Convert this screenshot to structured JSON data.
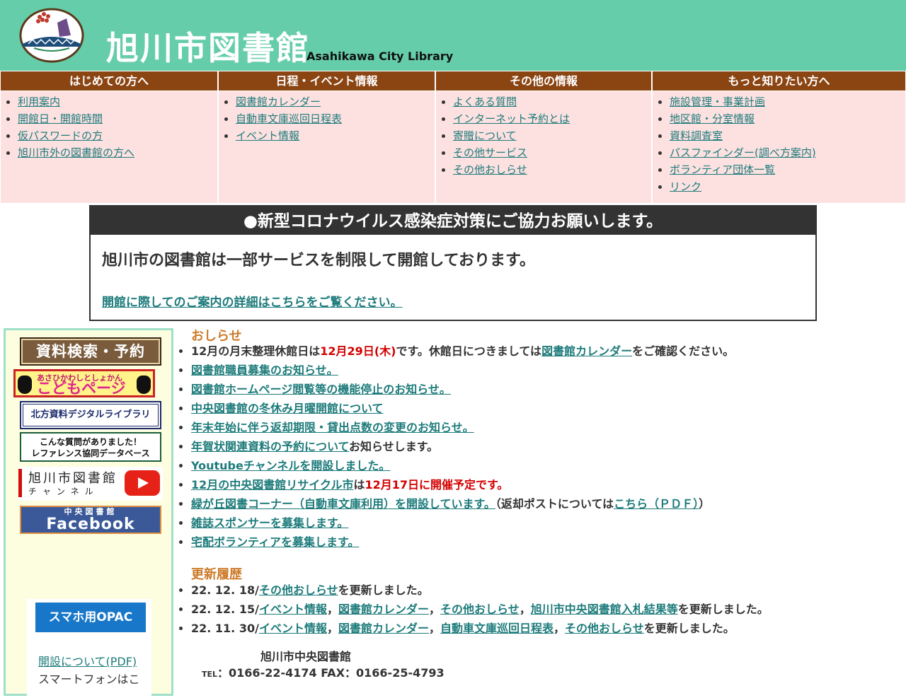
{
  "header": {
    "title": "旭川市図書館",
    "subtitle": "Asahikawa City Library",
    "logo_text": "あさひかわしとしょかん"
  },
  "nav": [
    {
      "heading": "はじめての方へ",
      "items": [
        "利用案内",
        "開館日・開館時間",
        "仮パスワードの方",
        "旭川市外の図書館の方へ"
      ]
    },
    {
      "heading": "日程・イベント情報",
      "items": [
        "図書館カレンダー",
        "自動車文庫巡回日程表",
        "イベント情報"
      ]
    },
    {
      "heading": "その他の情報",
      "items": [
        "よくある質問",
        "インターネット予約とは",
        "寄贈について",
        "その他サービス",
        "その他おしらせ"
      ]
    },
    {
      "heading": "もっと知りたい方へ",
      "items": [
        "施設管理・事業計画",
        "地区館・分室情報",
        "資料調査室",
        "パスファインダー(調べ方案内)",
        "ボランティア団体一覧",
        "リンク"
      ]
    }
  ],
  "notice": {
    "title": "●新型コロナウイルス感染症対策にご協力お願いします。",
    "body": "旭川市の図書館は一部サービスを制限して開館しております。",
    "link": "開館に際してのご案内の詳細はこちらをご覧ください。"
  },
  "sidebar": {
    "search_banner": "資料検索・予約",
    "kids_small": "あさひかわしとしょかん",
    "kids_big": "こどもページ",
    "digital_banner": "北方資料デジタルライブラリ",
    "ref_line1": "こんな質問がありました！",
    "ref_line2": "レファレンス協同データベース",
    "yt_line1": "旭川市図書館",
    "yt_line2": "チャンネル",
    "fb_line1": "中央図書館",
    "fb_line2": "Facebook",
    "opac_banner": "スマホ用OPAC",
    "opac_link": "開設について(PDF)",
    "opac_note": "スマートフォンはこ"
  },
  "news": {
    "title": "おしらせ",
    "items": {
      "n1": {
        "t1": "12月の月末整理休館日は",
        "red": "12月29日(木)",
        "t2": "です。休館日につきましては",
        "link": "図書館カレンダー",
        "t3": "をご確認ください。"
      },
      "n2": "図書館職員募集のお知らせ。",
      "n3": "図書館ホームページ閲覧等の機能停止のお知らせ。",
      "n4": "中央図書館の冬休み月曜開館について",
      "n5": "年末年始に伴う返却期限・貸出点数の変更のお知らせ。",
      "n6": {
        "link": "年賀状関連資料の予約について",
        "t1": "お知らせします。"
      },
      "n7": "Youtubeチャンネルを開設しました。",
      "n8": {
        "link": "12月の中央図書館リサイクル市",
        "t1": "は",
        "red": "12月17日に開催予定です。"
      },
      "n9": {
        "link": "緑が丘図書コーナー（自動車文庫利用）を開設しています。",
        "t1": "（返却ポストについては",
        "link2": "こちら（ＰＤＦ）",
        "t2": "）"
      },
      "n10": "雑誌スポンサーを募集します。",
      "n11": "宅配ボランティアを募集します。"
    }
  },
  "history": {
    "title": "更新履歴",
    "entries": [
      {
        "date": "22. 12. 18/",
        "links": [
          "その他おしらせ"
        ],
        "suffix": "を更新しました。"
      },
      {
        "date": "22. 12. 15/",
        "links": [
          "イベント情報",
          "図書館カレンダー",
          "その他おしらせ",
          "旭川市中央図書館入札結果等"
        ],
        "suffix": "を更新しました。"
      },
      {
        "date": "22. 11. 30/",
        "links": [
          "イベント情報",
          "図書館カレンダー",
          "自動車文庫巡回日程表",
          "その他おしらせ"
        ],
        "suffix": "を更新しました。"
      }
    ],
    "sep": "，"
  },
  "footer": {
    "name": "旭川市中央図書館",
    "tel_label": "TEL",
    "tel": "：0166-22-4174 FAX：0166-25-4793"
  },
  "colors": {
    "header_bg": "#66cdaa",
    "nav_head": "#8b4513",
    "nav_bg": "#fde1e1",
    "link": "#1e7b7b",
    "accent": "#cc7a29",
    "alert": "#d40000"
  }
}
